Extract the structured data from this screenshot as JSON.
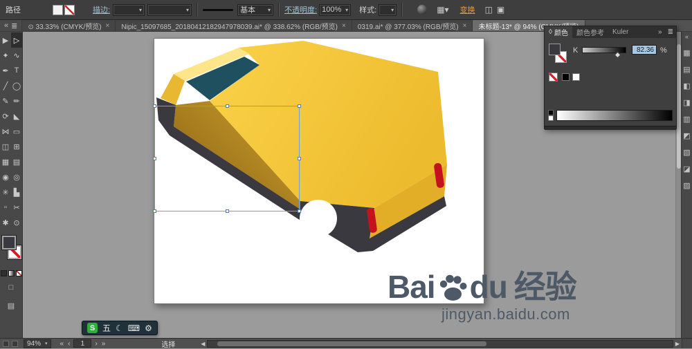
{
  "options_bar": {
    "mode_label": "路径",
    "stroke_label": "描边:",
    "brush_label": "基本",
    "opacity_label": "不透明度:",
    "opacity_value": "100%",
    "style_label": "样式:",
    "transform_label": "变换"
  },
  "tab_strip": {
    "scroll_left_icon": "«",
    "list_icon": "≣"
  },
  "document_tabs": [
    {
      "label": "⊙ 33.33% (CMYK/预览)",
      "close": "×",
      "active": false
    },
    {
      "label": "Nipic_15097685_20180412182947978039.ai* @ 338.62% (RGB/预览)",
      "close": "×",
      "active": false
    },
    {
      "label": "0319.ai* @ 377.03% (RGB/预览)",
      "close": "×",
      "active": false
    },
    {
      "label": "未标题-13* @ 94% (CMYK/预览)",
      "close": "",
      "active": true
    }
  ],
  "toolbar_tools": [
    {
      "name": "selection-tool",
      "glyph": "▶"
    },
    {
      "name": "direct-selection-tool",
      "glyph": "▷"
    },
    {
      "name": "magic-wand-tool",
      "glyph": "✦"
    },
    {
      "name": "lasso-tool",
      "glyph": "∿"
    },
    {
      "name": "pen-tool",
      "glyph": "✒"
    },
    {
      "name": "type-tool",
      "glyph": "T"
    },
    {
      "name": "line-segment-tool",
      "glyph": "╱"
    },
    {
      "name": "ellipse-tool",
      "glyph": "◯"
    },
    {
      "name": "paintbrush-tool",
      "glyph": "✎"
    },
    {
      "name": "pencil-tool",
      "glyph": "✏"
    },
    {
      "name": "rotate-tool",
      "glyph": "⟳"
    },
    {
      "name": "scale-tool",
      "glyph": "◣"
    },
    {
      "name": "width-tool",
      "glyph": "⋈"
    },
    {
      "name": "free-transform-tool",
      "glyph": "▭"
    },
    {
      "name": "shape-builder-tool",
      "glyph": "◫"
    },
    {
      "name": "perspective-grid-tool",
      "glyph": "⊞"
    },
    {
      "name": "mesh-tool",
      "glyph": "▦"
    },
    {
      "name": "gradient-tool",
      "glyph": "▤"
    },
    {
      "name": "eyedropper-tool",
      "glyph": "◉"
    },
    {
      "name": "blend-tool",
      "glyph": "◎"
    },
    {
      "name": "symbol-sprayer-tool",
      "glyph": "✳"
    },
    {
      "name": "column-graph-tool",
      "glyph": "▙"
    },
    {
      "name": "artboard-tool",
      "glyph": "▫"
    },
    {
      "name": "slice-tool",
      "glyph": "✂"
    },
    {
      "name": "hand-tool",
      "glyph": "✱"
    },
    {
      "name": "zoom-tool",
      "glyph": "⊙"
    }
  ],
  "toolbar_modes": {
    "draw_normal_icon": "□",
    "screen_mode_icon": "▤"
  },
  "color_panel": {
    "panel_icon": "◊",
    "tabs": [
      "颜色",
      "颜色参考",
      "Kuler"
    ],
    "active_tab": "颜色",
    "channel_label": "K",
    "channel_value": "82.36",
    "percent_sign": "%",
    "overflow_icon": "»",
    "menu_icon": "≣"
  },
  "right_dock": {
    "collapse_icon": "«",
    "icons": [
      {
        "name": "dock-color-icon",
        "glyph": "▦"
      },
      {
        "name": "dock-swatches-icon",
        "glyph": "▤"
      },
      {
        "name": "dock-brushes-icon",
        "glyph": "◧"
      },
      {
        "name": "dock-symbols-icon",
        "glyph": "◨"
      },
      {
        "name": "dock-stroke-icon",
        "glyph": "▥"
      },
      {
        "name": "dock-gradient-icon",
        "glyph": "◩"
      },
      {
        "name": "dock-transparency-icon",
        "glyph": "▧"
      },
      {
        "name": "dock-appearance-icon",
        "glyph": "◪"
      },
      {
        "name": "dock-layers-icon",
        "glyph": "▨"
      }
    ]
  },
  "status_bar": {
    "zoom": "94%",
    "nav_first": "«",
    "nav_prev": "‹",
    "artboard_number": "1",
    "nav_next": "›",
    "nav_last": "»",
    "tool_status": "选择"
  },
  "ime_bar": {
    "items": [
      {
        "name": "sogou-logo",
        "glyph": "S"
      },
      {
        "name": "input-mode-wubi",
        "glyph": "五"
      },
      {
        "name": "night-mode-icon",
        "glyph": "☾"
      },
      {
        "name": "soft-keyboard-icon",
        "glyph": "⌨"
      },
      {
        "name": "toolbox-icon",
        "glyph": "⚙"
      }
    ]
  },
  "watermark": {
    "brand_prefix": "Bai",
    "brand_suffix": "du",
    "brand_cn": "经验",
    "url": "jingyan.baidu.com"
  },
  "artwork": {
    "description": "Yellow isometric delivery van, rear three-quarter view, selected with bounding box",
    "colors": {
      "highlight": "#ffe58a",
      "roof": "#fbd249",
      "roofDeep": "#edbb2e",
      "side": "#cfa02e",
      "sideDark": "#8a6413",
      "rear": "#e3ae27",
      "hood": "#e8b832",
      "window": "#1f5060",
      "chassis": "#3a393f",
      "taillight": "#c5121f",
      "selection": "#6fa0d4"
    }
  }
}
